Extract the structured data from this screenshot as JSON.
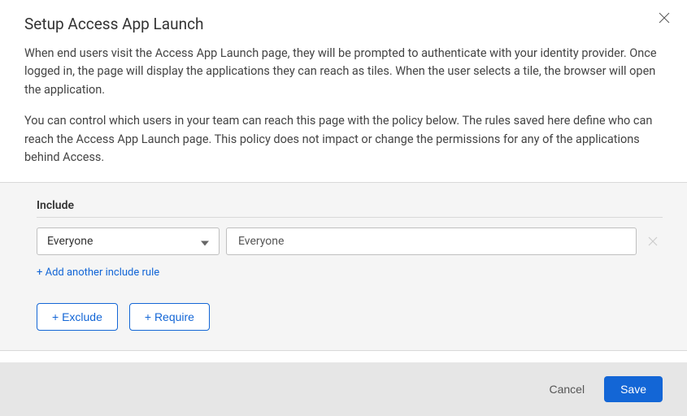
{
  "dialog": {
    "title": "Setup Access App Launch",
    "paragraph1": "When end users visit the Access App Launch page, they will be prompted to authenticate with your identity provider. Once logged in, the page will display the applications they can reach as tiles. When the user selects a tile, the browser will open the application.",
    "paragraph2": "You can control which users in your team can reach this page with the policy below. The rules saved here define who can reach the Access App Launch page. This policy does not impact or change the permissions for any of the applications behind Access."
  },
  "policy": {
    "include_label": "Include",
    "selector_value": "Everyone",
    "value_display": "Everyone",
    "add_rule_label": "+ Add another include rule",
    "exclude_label": "+ Exclude",
    "require_label": "+ Require"
  },
  "footer": {
    "cancel": "Cancel",
    "save": "Save"
  }
}
